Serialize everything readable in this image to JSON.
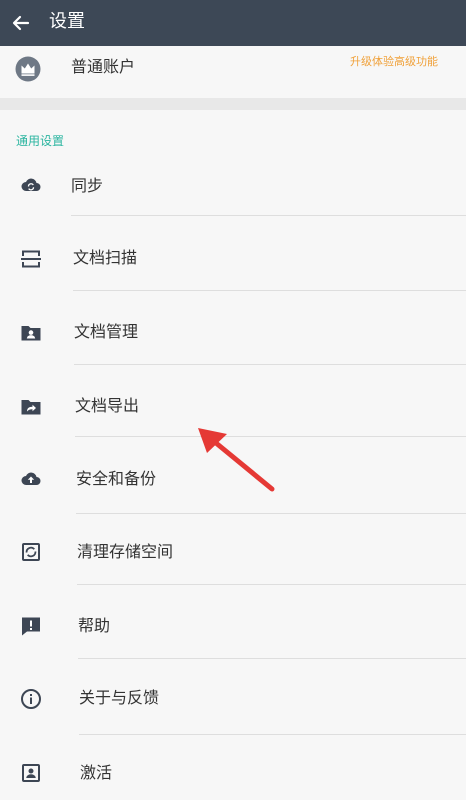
{
  "appbar": {
    "title": "设置",
    "back_icon": "arrow-back-icon"
  },
  "account": {
    "icon": "crown-icon",
    "label": "普通账户",
    "upgrade_label": "升级体验高级功能"
  },
  "section": {
    "header": "通用设置"
  },
  "menu": [
    {
      "key": "sync",
      "label": "同步",
      "icon": "cloud-sync-icon"
    },
    {
      "key": "scan",
      "label": "文档扫描",
      "icon": "scan-icon"
    },
    {
      "key": "manage",
      "label": "文档管理",
      "icon": "folder-person-icon"
    },
    {
      "key": "export",
      "label": "文档导出",
      "icon": "folder-share-icon"
    },
    {
      "key": "backup",
      "label": "安全和备份",
      "icon": "cloud-upload-icon"
    },
    {
      "key": "storage",
      "label": "清理存储空间",
      "icon": "clean-storage-icon"
    },
    {
      "key": "help",
      "label": "帮助",
      "icon": "feedback-icon"
    },
    {
      "key": "about",
      "label": "关于与反馈",
      "icon": "info-icon"
    },
    {
      "key": "activate",
      "label": "激活",
      "icon": "account-box-icon"
    }
  ],
  "colors": {
    "appbar": "#3d4856",
    "accent": "#2bb5a0",
    "upgrade": "#f0a13a",
    "annotation": "#e53935",
    "icon": "#3d4654"
  }
}
